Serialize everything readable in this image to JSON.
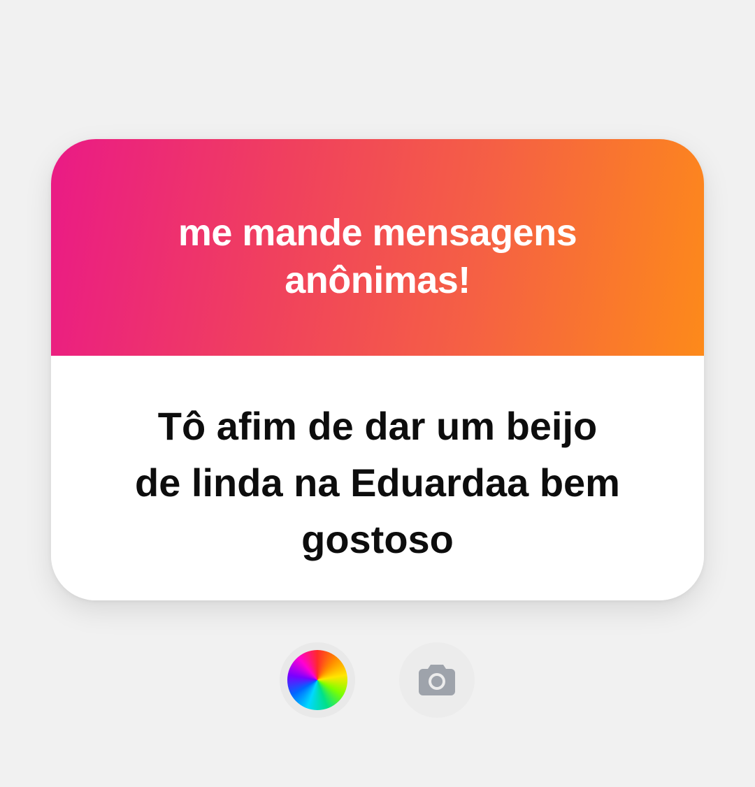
{
  "sticker": {
    "prompt": "me mande mensagens\nanônimas!",
    "response": "Tô afim de dar um beijo\nde linda na Eduardaa bem\ngostoso"
  },
  "tools": {
    "color_picker": {
      "icon": "color-wheel-icon"
    },
    "camera": {
      "icon": "camera-icon"
    }
  },
  "colors": {
    "background": "#f1f1f1",
    "gradient_start": "#ea1a86",
    "gradient_end": "#fd8a1a",
    "prompt_text": "#ffffff",
    "response_text": "#0d0d0d",
    "camera_icon": "#9ea3ab"
  }
}
